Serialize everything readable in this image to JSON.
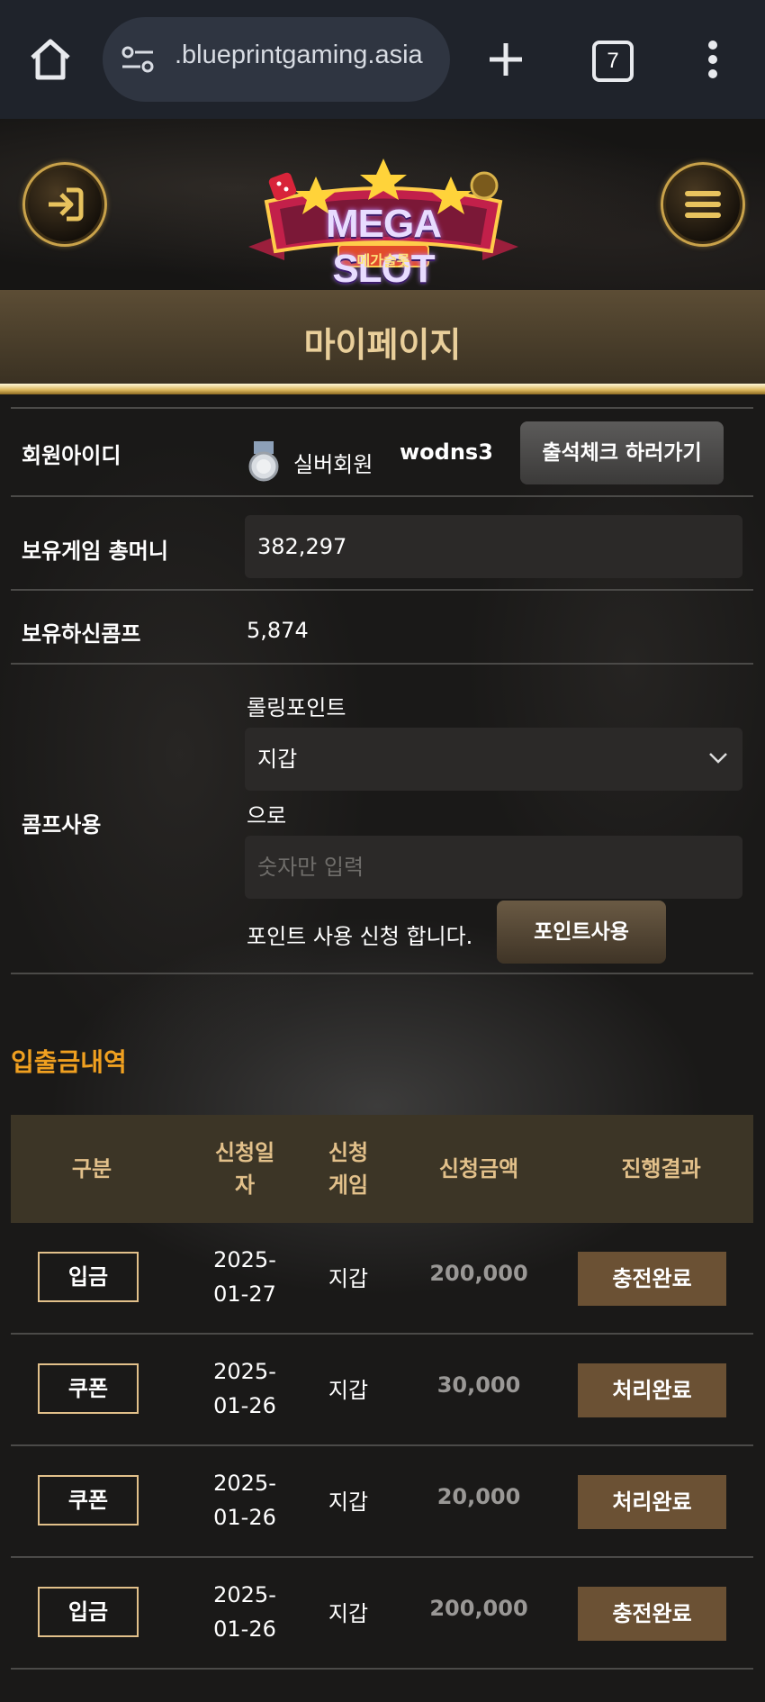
{
  "browser": {
    "url": ".blueprintgaming.asia",
    "tab_count": "7"
  },
  "header": {
    "logo_text": "MEGA SLOT",
    "logo_subtext": "메가슬롯"
  },
  "page": {
    "title": "마이페이지"
  },
  "profile": {
    "member_id_label": "회원아이디",
    "member_grade": "실버회원",
    "member_id": "wodns3",
    "attendance_button": "출석체크 하러가기",
    "money_label": "보유게임 총머니",
    "money_value": "382,297",
    "comp_label": "보유하신콤프",
    "comp_value": "5,874",
    "comp_use_label": "콤프사용",
    "rolling_point_label": "롤링포인트",
    "wallet_select_value": "지갑",
    "to_label": "으로",
    "amount_placeholder": "숫자만 입력",
    "request_text": "포인트 사용 신청 합니다.",
    "use_point_button": "포인트사용"
  },
  "history": {
    "title": "입출금내역",
    "columns": [
      "구분",
      "신청일자",
      "신청게임",
      "신청금액",
      "진행결과"
    ],
    "rows": [
      {
        "type": "입금",
        "date": "2025-01-27",
        "game": "지갑",
        "amount": "200,000",
        "status": "충전완료"
      },
      {
        "type": "쿠폰",
        "date": "2025-01-26",
        "game": "지갑",
        "amount": "30,000",
        "status": "처리완료"
      },
      {
        "type": "쿠폰",
        "date": "2025-01-26",
        "game": "지갑",
        "amount": "20,000",
        "status": "처리완료"
      },
      {
        "type": "입금",
        "date": "2025-01-26",
        "game": "지갑",
        "amount": "200,000",
        "status": "충전완료"
      }
    ]
  }
}
